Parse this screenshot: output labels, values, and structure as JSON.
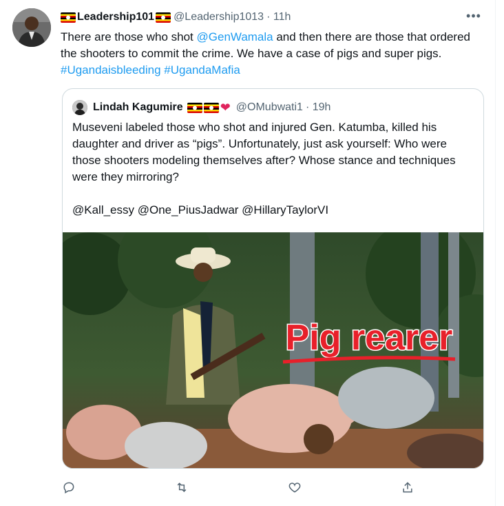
{
  "tweet": {
    "author_name": "Leadership101",
    "author_handle": "@Leadership1013",
    "time": "· 11h",
    "more_icon": "•••",
    "text": {
      "part1": "There are those who shot ",
      "mention": "@GenWamala",
      "part2": " and then there are those that ordered the shooters to commit the crime. We have a case of pigs and super pigs. ",
      "hashtag1": "#Ugandaisbleeding",
      "hashtag2": "#UgandaMafia"
    }
  },
  "quote": {
    "author_name": "Lindah Kagumire",
    "author_handle": "@OMubwati1",
    "time": "· 19h",
    "text": "Museveni labeled those who shot and injured Gen. Katumba, killed his daughter and driver as “pigs”. Unfortunately, just ask yourself: Who were those shooters modeling themselves after? Whose stance and techniques were they mirroring?",
    "mentions": "@Kall_essy @One_PiusJadwar @HillaryTaylorVI",
    "image_caption": "Pig rearer"
  },
  "colors": {
    "link": "#1d9bf0",
    "muted": "#536471",
    "border": "#cfd9de",
    "caption_red": "#e8202a"
  },
  "icons": {
    "reply": "reply-icon",
    "retweet": "retweet-icon",
    "like": "heart-icon",
    "share": "share-icon"
  }
}
